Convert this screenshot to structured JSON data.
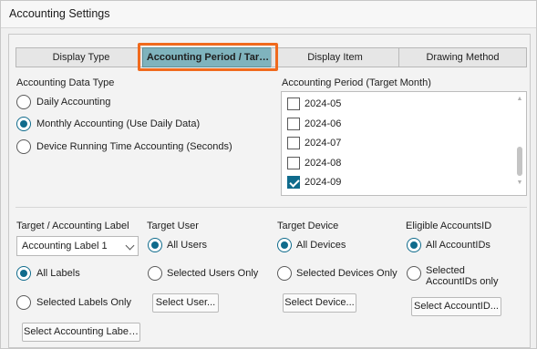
{
  "window": {
    "title": "Accounting Settings"
  },
  "tabs": [
    {
      "label": "Display Type",
      "active": false
    },
    {
      "label": "Accounting Period / Tar…",
      "active": true
    },
    {
      "label": "Display Item",
      "active": false
    },
    {
      "label": "Drawing Method",
      "active": false
    }
  ],
  "accounting_data_type": {
    "heading": "Accounting Data Type",
    "options": [
      {
        "label": "Daily Accounting",
        "selected": false
      },
      {
        "label": "Monthly Accounting (Use Daily Data)",
        "selected": true
      },
      {
        "label": "Device Running Time Accounting (Seconds)",
        "selected": false
      }
    ]
  },
  "accounting_period": {
    "heading": "Accounting Period (Target Month)",
    "months": [
      {
        "label": "2024-05",
        "checked": false
      },
      {
        "label": "2024-06",
        "checked": false
      },
      {
        "label": "2024-07",
        "checked": false
      },
      {
        "label": "2024-08",
        "checked": false
      },
      {
        "label": "2024-09",
        "checked": true
      }
    ]
  },
  "target_label": {
    "heading": "Target / Accounting Label",
    "select_value": "Accounting Label 1",
    "options": [
      {
        "label": "All Labels",
        "selected": true
      },
      {
        "label": "Selected Labels Only",
        "selected": false
      }
    ],
    "button": "Select Accounting Labe…"
  },
  "target_user": {
    "heading": "Target User",
    "options": [
      {
        "label": "All Users",
        "selected": true
      },
      {
        "label": "Selected Users Only",
        "selected": false
      }
    ],
    "button": "Select User..."
  },
  "target_device": {
    "heading": "Target Device",
    "options": [
      {
        "label": "All Devices",
        "selected": true
      },
      {
        "label": "Selected Devices Only",
        "selected": false
      }
    ],
    "button": "Select Device..."
  },
  "eligible_accounts": {
    "heading": "Eligible AccountsID",
    "options": [
      {
        "label": "All AccountIDs",
        "selected": true
      },
      {
        "label": "Selected AccountIDs only",
        "selected": false
      }
    ],
    "button": "Select AccountID..."
  },
  "colors": {
    "accent": "#0f6b8c",
    "active_tab": "#7fb3bd",
    "highlight": "#f06a1d"
  }
}
